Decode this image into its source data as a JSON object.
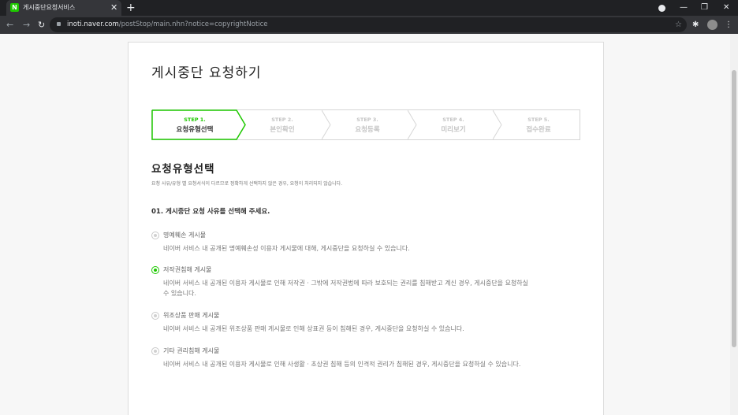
{
  "browser": {
    "tab_title": "게시중단요청서비스",
    "favicon_letter": "N",
    "url_host": "inoti.naver.com",
    "url_path": "/postStop/main.nhn?notice=copyrightNotice"
  },
  "page": {
    "title": "게시중단 요청하기",
    "steps": [
      {
        "num": "STEP 1.",
        "name": "요청유형선택",
        "active": true
      },
      {
        "num": "STEP 2.",
        "name": "본인확인",
        "active": false
      },
      {
        "num": "STEP 3.",
        "name": "요청등록",
        "active": false
      },
      {
        "num": "STEP 4.",
        "name": "미리보기",
        "active": false
      },
      {
        "num": "STEP 5.",
        "name": "접수완료",
        "active": false
      }
    ],
    "section_title": "요청유형선택",
    "section_desc": "요청 사유/유형 별 요청서식이 다르므로 정확하게 선택하지 않은 경우, 요청이 처리되지 않습니다.",
    "question": "01. 게시중단 요청 사유를 선택해 주세요.",
    "options": [
      {
        "label": "명예훼손 게시물",
        "desc": "네이버 서비스 내 공개된 명예훼손성 이용자 게시물에 대해, 게시중단을 요청하실 수 있습니다.",
        "selected": false
      },
      {
        "label": "저작권침해 게시물",
        "desc": "네이버 서비스 내 공개된 이용자 게시물로 인해 저작권 · 그밖에 저작권법에 따라 보호되는 권리를 침해받고 계신 경우, 게시중단을 요청하실 수 있습니다.",
        "selected": true
      },
      {
        "label": "위조상품 판매 게시물",
        "desc": "네이버 서비스 내 공개된 위조상품 판매 게시물로 인해 상표권 등이 침해된 경우, 게시중단을 요청하실 수 있습니다.",
        "selected": false
      },
      {
        "label": "기타 권리침해 게시물",
        "desc": "네이버 서비스 내 공개된 이용자 게시물로 인해 사생활 · 초상권 침해 등의 인격적 권리가 침해된 경우, 게시중단을 요청하실 수 있습니다.",
        "selected": false
      }
    ]
  },
  "colors": {
    "accent": "#1ec800",
    "chrome_dark": "#202124",
    "chrome_tab": "#35363a"
  }
}
